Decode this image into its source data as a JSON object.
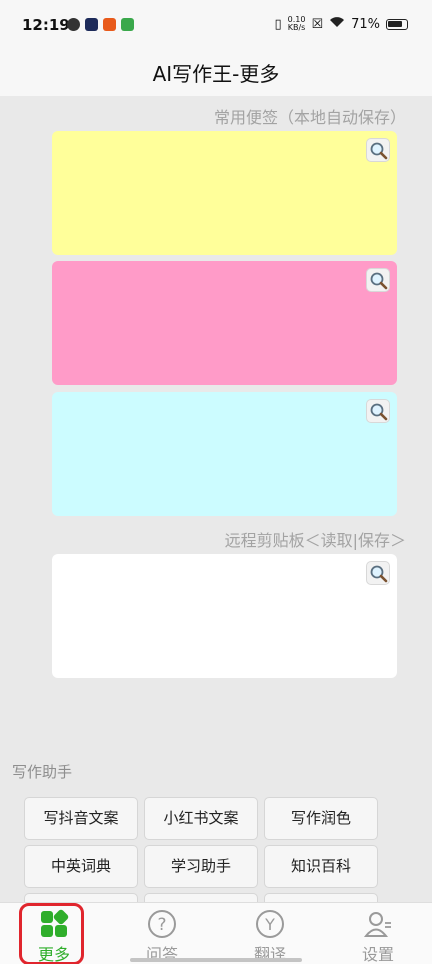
{
  "status_bar": {
    "time": "12:19",
    "net_speed_value": "0.10",
    "net_speed_unit": "KB/s",
    "battery": "71%"
  },
  "header": {
    "title": "AI写作王-更多"
  },
  "notes_section": {
    "label": "常用便签（本地自动保存）"
  },
  "clipboard_section": {
    "label": "远程剪贴板＜读取|保存＞"
  },
  "notes": [
    {
      "color": "#ffff9a"
    },
    {
      "color": "#ff9bc8"
    },
    {
      "color": "#ccfcff"
    },
    {
      "color": "#ffffff"
    }
  ],
  "assistant": {
    "label": "写作助手",
    "buttons": [
      "写抖音文案",
      "小红书文案",
      "写作润色",
      "中英词典",
      "学习助手",
      "知识百科"
    ]
  },
  "bottom_nav": {
    "items": [
      {
        "label": "更多",
        "icon": "grid-apps-icon",
        "active": true
      },
      {
        "label": "问答",
        "icon": "question-circle-icon",
        "active": false
      },
      {
        "label": "翻译",
        "icon": "translate-y-icon",
        "active": false
      },
      {
        "label": "设置",
        "icon": "user-settings-icon",
        "active": false
      }
    ]
  },
  "colors": {
    "accent": "#2fae2b",
    "highlight_ring": "#e0252d"
  }
}
